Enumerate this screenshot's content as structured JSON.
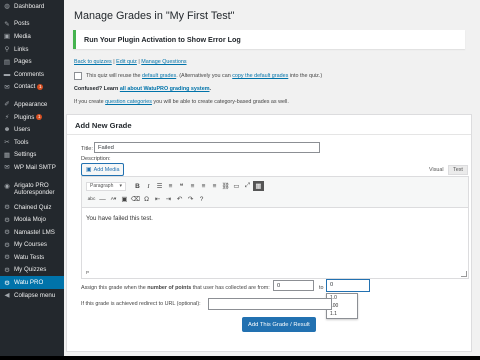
{
  "sidebar": {
    "items": [
      {
        "label": "Dashboard",
        "icon": "dashboard-icon",
        "glyph": "◍"
      },
      {
        "sep": true
      },
      {
        "label": "Posts",
        "icon": "pin-icon",
        "glyph": "✎"
      },
      {
        "label": "Media",
        "icon": "media-icon",
        "glyph": "▣"
      },
      {
        "label": "Links",
        "icon": "link-icon",
        "glyph": "⚲"
      },
      {
        "label": "Pages",
        "icon": "page-icon",
        "glyph": "▤"
      },
      {
        "label": "Comments",
        "icon": "comment-icon",
        "glyph": "▬"
      },
      {
        "label": "Contact",
        "icon": "mail-icon",
        "glyph": "✉",
        "badge": "1"
      },
      {
        "sep": true
      },
      {
        "label": "Appearance",
        "icon": "brush-icon",
        "glyph": "✐"
      },
      {
        "label": "Plugins",
        "icon": "plugin-icon",
        "glyph": "⚡",
        "badge": "1"
      },
      {
        "label": "Users",
        "icon": "users-icon",
        "glyph": "☻"
      },
      {
        "label": "Tools",
        "icon": "wrench-icon",
        "glyph": "✂"
      },
      {
        "label": "Settings",
        "icon": "settings-icon",
        "glyph": "▦"
      },
      {
        "label": "WP Mail SMTP",
        "icon": "smtp-icon",
        "glyph": "✉"
      },
      {
        "sep": true
      },
      {
        "label": "Arigato PRO Autoresponder",
        "icon": "autoresponder-icon",
        "glyph": "◉",
        "two": true
      },
      {
        "label": "Chained Quiz",
        "icon": "chained-quiz-icon",
        "glyph": "⚙"
      },
      {
        "label": "Moola Mojo",
        "icon": "moola-mojo-icon",
        "glyph": "⚙"
      },
      {
        "label": "Namaste! LMS",
        "icon": "namaste-lms-icon",
        "glyph": "⚙"
      },
      {
        "label": "My Courses",
        "icon": "my-courses-icon",
        "glyph": "⚙"
      },
      {
        "label": "Watu Tests",
        "icon": "watu-tests-icon",
        "glyph": "⚙"
      },
      {
        "label": "My Quizzes",
        "icon": "my-quizzes-icon",
        "glyph": "⚙"
      },
      {
        "label": "Watu PRO",
        "icon": "watu-pro-icon",
        "glyph": "⚙",
        "active": true
      },
      {
        "label": "Collapse menu",
        "icon": "collapse-icon",
        "glyph": "◀"
      }
    ]
  },
  "page": {
    "title": "Manage Grades in \"My First Test\"",
    "notice": "Run Your Plugin Activation to Show Error Log",
    "links": {
      "back": "Back to quizzes",
      "sep1": " | ",
      "edit": "Edit quiz",
      "sep2": " | ",
      "questions": "Manage Questions"
    },
    "reuse": {
      "pre": "This quiz will reuse the ",
      "link1": "default grades",
      "mid": ". (Alternatively you can ",
      "link2": "copy the default grades",
      "post": " into the quiz.)"
    },
    "confused": {
      "pre": "Confused? Learn ",
      "link": "all about WatuPRO grading system",
      "post": "."
    },
    "categories": {
      "pre": "If you create ",
      "link": "question categories",
      "post": " you will be able to create category-based grades as well."
    }
  },
  "form": {
    "heading": "Add New Grade",
    "title_label": "Title:",
    "title_value": "Failed",
    "description_label": "Description:",
    "add_media": "Add Media",
    "tab_visual": "Visual",
    "tab_text": "Text",
    "format_select": "Paragraph",
    "editor_content": "You have failed this test.",
    "editor_path": "P",
    "assign_pre": "Assign this grade when the ",
    "assign_bold": "number of points",
    "assign_post": " that user has collected are from:",
    "from_value": "0",
    "to_label": "to",
    "to_value": "0",
    "autocomplete": [
      "1.0",
      "100",
      "1.1"
    ],
    "redirect_label": "If this grade is achieved redirect to URL (optional):",
    "redirect_value": "",
    "submit": "Add This Grade / Result"
  },
  "toolbar": {
    "row1": [
      {
        "icon": "bold-icon",
        "glyph": "B",
        "cls": "b"
      },
      {
        "icon": "italic-icon",
        "glyph": "I",
        "cls": "i"
      },
      {
        "icon": "bullet-list-icon",
        "glyph": "☰",
        "cls": ""
      },
      {
        "icon": "numbered-list-icon",
        "glyph": "≡",
        "cls": ""
      },
      {
        "icon": "blockquote-icon",
        "glyph": "❝",
        "cls": ""
      },
      {
        "icon": "align-left-icon",
        "glyph": "≡",
        "cls": ""
      },
      {
        "icon": "align-center-icon",
        "glyph": "≡",
        "cls": ""
      },
      {
        "icon": "align-right-icon",
        "glyph": "≡",
        "cls": ""
      },
      {
        "icon": "link-icon",
        "glyph": "⛓",
        "cls": ""
      },
      {
        "icon": "read-more-icon",
        "glyph": "▭",
        "cls": ""
      },
      {
        "icon": "fullscreen-icon",
        "glyph": "⤢",
        "cls": ""
      },
      {
        "icon": "toolbar-toggle-icon",
        "glyph": "▦",
        "cls": "on"
      }
    ],
    "row2": [
      {
        "icon": "strikethrough-icon",
        "glyph": "abc",
        "cls": ""
      },
      {
        "icon": "horizontal-line-icon",
        "glyph": "—",
        "cls": ""
      },
      {
        "icon": "text-color-icon",
        "glyph": "A▾",
        "cls": ""
      },
      {
        "icon": "paste-text-icon",
        "glyph": "▣",
        "cls": ""
      },
      {
        "icon": "clear-formatting-icon",
        "glyph": "⌫",
        "cls": ""
      },
      {
        "icon": "special-character-icon",
        "glyph": "Ω",
        "cls": ""
      },
      {
        "icon": "outdent-icon",
        "glyph": "⇤",
        "cls": ""
      },
      {
        "icon": "indent-icon",
        "glyph": "⇥",
        "cls": ""
      },
      {
        "icon": "undo-icon",
        "glyph": "↶",
        "cls": ""
      },
      {
        "icon": "redo-icon",
        "glyph": "↷",
        "cls": ""
      },
      {
        "icon": "help-icon",
        "glyph": "?",
        "cls": ""
      }
    ]
  }
}
